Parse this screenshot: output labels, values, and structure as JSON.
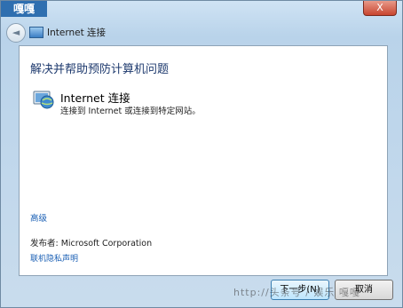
{
  "window": {
    "corner_tag": "嘎嘎",
    "close_label": "X",
    "title": "Internet 连接"
  },
  "nav": {
    "back_glyph": "◄"
  },
  "content": {
    "heading": "解决并帮助预防计算机问题",
    "task": {
      "title": "Internet 连接",
      "description": "连接到 Internet 或连接到特定网站。",
      "icon": "network-globe-icon"
    },
    "advanced_link": "高级",
    "publisher": "发布者: Microsoft Corporation",
    "privacy_link": "联机隐私声明"
  },
  "footer": {
    "next_label": "下一步(N)",
    "cancel_label": "取消"
  },
  "watermark": "http://头条号 / 娱乐 嘎嘎"
}
